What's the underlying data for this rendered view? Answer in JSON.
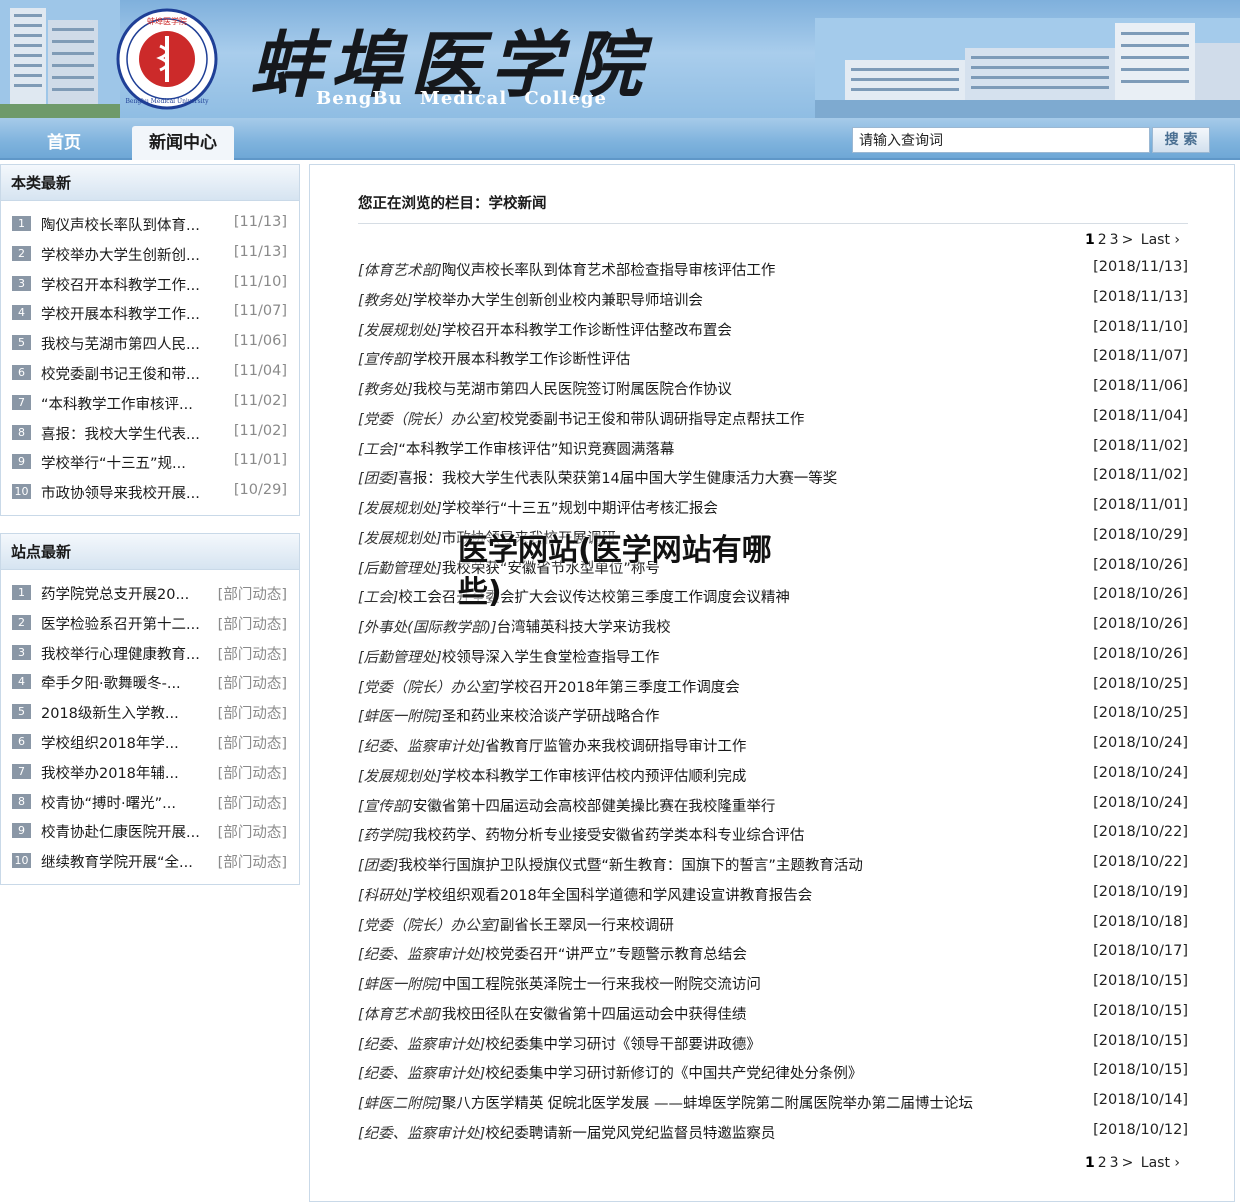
{
  "header": {
    "title": "蚌埠医学院",
    "subtitle": "BengBu Medical College",
    "seal_text": "Bengbu Medical University"
  },
  "nav": {
    "tabs": [
      {
        "label": "首页"
      },
      {
        "label": "新闻中心"
      }
    ],
    "search": {
      "placeholder": "请输入查询词",
      "button": "搜 索"
    }
  },
  "sidebar": {
    "latest": {
      "heading": "本类最新",
      "items": [
        {
          "num": "1",
          "text": "陶仪声校长率队到体育...",
          "date": "[11/13]"
        },
        {
          "num": "2",
          "text": "学校举办大学生创新创...",
          "date": "[11/13]"
        },
        {
          "num": "3",
          "text": "学校召开本科教学工作...",
          "date": "[11/10]"
        },
        {
          "num": "4",
          "text": "学校开展本科教学工作...",
          "date": "[11/07]"
        },
        {
          "num": "5",
          "text": "我校与芜湖市第四人民...",
          "date": "[11/06]"
        },
        {
          "num": "6",
          "text": "校党委副书记王俊和带...",
          "date": "[11/04]"
        },
        {
          "num": "7",
          "text": "“本科教学工作审核评...",
          "date": "[11/02]"
        },
        {
          "num": "8",
          "text": "喜报：我校大学生代表...",
          "date": "[11/02]"
        },
        {
          "num": "9",
          "text": "学校举行“十三五”规...",
          "date": "[11/01]"
        },
        {
          "num": "10",
          "text": "市政协领导来我校开展...",
          "date": "[10/29]"
        }
      ]
    },
    "site": {
      "heading": "站点最新",
      "items": [
        {
          "num": "1",
          "text": "药学院党总支开展20...",
          "date": "[部门动态]"
        },
        {
          "num": "2",
          "text": "医学检验系召开第十二...",
          "date": "[部门动态]"
        },
        {
          "num": "3",
          "text": "我校举行心理健康教育...",
          "date": "[部门动态]"
        },
        {
          "num": "4",
          "text": "牵手夕阳·歌舞暖冬-...",
          "date": "[部门动态]"
        },
        {
          "num": "5",
          "text": "2018级新生入学教...",
          "date": "[部门动态]"
        },
        {
          "num": "6",
          "text": "学校组织2018年学...",
          "date": "[部门动态]"
        },
        {
          "num": "7",
          "text": "我校举办2018年辅...",
          "date": "[部门动态]"
        },
        {
          "num": "8",
          "text": "校青协“搏时·曙光”...",
          "date": "[部门动态]"
        },
        {
          "num": "9",
          "text": "校青协赴仁康医院开展...",
          "date": "[部门动态]"
        },
        {
          "num": "10",
          "text": "继续教育学院开展“全...",
          "date": "[部门动态]"
        }
      ]
    }
  },
  "main": {
    "breadcrumb": "您正在浏览的栏目：学校新闻",
    "pager": {
      "current": "1",
      "pages": [
        "2",
        "3",
        ">"
      ],
      "last": "Last ›"
    },
    "news": [
      {
        "cat": "[体育艺术部]",
        "title": "陶仪声校长率队到体育艺术部检查指导审核评估工作",
        "date": "[2018/11/13]"
      },
      {
        "cat": "[教务处]",
        "title": "学校举办大学生创新创业校内兼职导师培训会",
        "date": "[2018/11/13]"
      },
      {
        "cat": "[发展规划处]",
        "title": "学校召开本科教学工作诊断性评估整改布置会",
        "date": "[2018/11/10]"
      },
      {
        "cat": "[宣传部]",
        "title": "学校开展本科教学工作诊断性评估",
        "date": "[2018/11/07]"
      },
      {
        "cat": "[教务处]",
        "title": "我校与芜湖市第四人民医院签订附属医院合作协议",
        "date": "[2018/11/06]"
      },
      {
        "cat": "[党委（院长）办公室]",
        "title": "校党委副书记王俊和带队调研指导定点帮扶工作",
        "date": "[2018/11/04]"
      },
      {
        "cat": "[工会]",
        "title": "“本科教学工作审核评估”知识竞赛圆满落幕",
        "date": "[2018/11/02]"
      },
      {
        "cat": "[团委]",
        "title": "喜报：我校大学生代表队荣获第14届中国大学生健康活力大赛一等奖",
        "date": "[2018/11/02]"
      },
      {
        "cat": "[发展规划处]",
        "title": "学校举行“十三五”规划中期评估考核汇报会",
        "date": "[2018/11/01]"
      },
      {
        "cat": "[发展规划处]",
        "title": "市政协领导来我校开展调研",
        "date": "[2018/10/29]"
      },
      {
        "cat": "[后勤管理处]",
        "title": "我校荣获“安徽省节水型单位”称号",
        "date": "[2018/10/26]"
      },
      {
        "cat": "[工会]",
        "title": "校工会召开全委会扩大会议传达校第三季度工作调度会议精神",
        "date": "[2018/10/26]"
      },
      {
        "cat": "[外事处(国际教学部)]",
        "title": "台湾辅英科技大学来访我校",
        "date": "[2018/10/26]"
      },
      {
        "cat": "[后勤管理处]",
        "title": "校领导深入学生食堂检查指导工作",
        "date": "[2018/10/26]"
      },
      {
        "cat": "[党委（院长）办公室]",
        "title": "学校召开2018年第三季度工作调度会",
        "date": "[2018/10/25]"
      },
      {
        "cat": "[蚌医一附院]",
        "title": "圣和药业来校洽谈产学研战略合作",
        "date": "[2018/10/25]"
      },
      {
        "cat": "[纪委、监察审计处]",
        "title": "省教育厅监管办来我校调研指导审计工作",
        "date": "[2018/10/24]"
      },
      {
        "cat": "[发展规划处]",
        "title": "学校本科教学工作审核评估校内预评估顺利完成",
        "date": "[2018/10/24]"
      },
      {
        "cat": "[宣传部]",
        "title": "安徽省第十四届运动会高校部健美操比赛在我校隆重举行",
        "date": "[2018/10/24]"
      },
      {
        "cat": "[药学院]",
        "title": "我校药学、药物分析专业接受安徽省药学类本科专业综合评估",
        "date": "[2018/10/22]"
      },
      {
        "cat": "[团委]",
        "title": "我校举行国旗护卫队授旗仪式暨“新生教育：国旗下的誓言”主题教育活动",
        "date": "[2018/10/22]"
      },
      {
        "cat": "[科研处]",
        "title": "学校组织观看2018年全国科学道德和学风建设宣讲教育报告会",
        "date": "[2018/10/19]"
      },
      {
        "cat": "[党委（院长）办公室]",
        "title": "副省长王翠凤一行来校调研",
        "date": "[2018/10/18]"
      },
      {
        "cat": "[纪委、监察审计处]",
        "title": "校党委召开“讲严立”专题警示教育总结会",
        "date": "[2018/10/17]"
      },
      {
        "cat": "[蚌医一附院]",
        "title": "中国工程院张英泽院士一行来我校一附院交流访问",
        "date": "[2018/10/15]"
      },
      {
        "cat": "[体育艺术部]",
        "title": "我校田径队在安徽省第十四届运动会中获得佳绩",
        "date": "[2018/10/15]"
      },
      {
        "cat": "[纪委、监察审计处]",
        "title": "校纪委集中学习研讨《领导干部要讲政德》",
        "date": "[2018/10/15]"
      },
      {
        "cat": "[纪委、监察审计处]",
        "title": "校纪委集中学习研讨新修订的《中国共产党纪律处分条例》",
        "date": "[2018/10/15]"
      },
      {
        "cat": "[蚌医二附院]",
        "title": "聚八方医学精英 促皖北医学发展 ——蚌埠医学院第二附属医院举办第二届博士论坛",
        "date": "[2018/10/14]"
      },
      {
        "cat": "[纪委、监察审计处]",
        "title": "校纪委聘请新一届党风党纪监督员特邀监察员",
        "date": "[2018/10/12]"
      }
    ]
  },
  "overlay": {
    "text": "医学网站(医学网站有哪些)"
  },
  "colors": {
    "banner": "#8fbde3",
    "nav": "#7fb3dd",
    "panel_head": "#d6e4f1",
    "num_badge": "#8a97a6"
  }
}
